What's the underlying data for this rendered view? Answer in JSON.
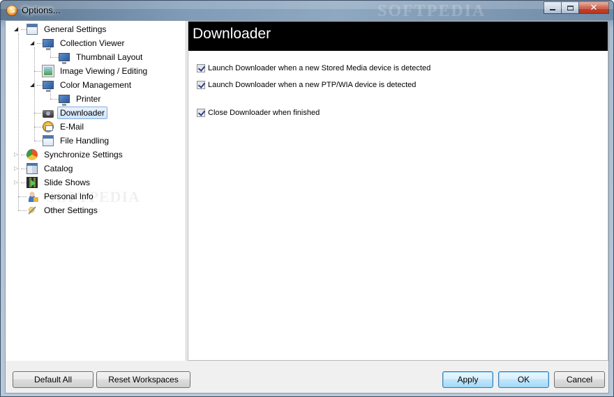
{
  "window": {
    "title": "Options...",
    "app_icon_glyph": "S",
    "watermark": "SOFTPEDIA",
    "controls": {
      "minimize": "minimize-icon",
      "maximize": "maximize-icon",
      "close": "✕"
    }
  },
  "tree": {
    "items": [
      {
        "label": "General Settings",
        "icon": "general-settings-icon",
        "expanded": true
      },
      {
        "label": "Collection Viewer",
        "icon": "collection-viewer-icon",
        "expanded": true
      },
      {
        "label": "Thumbnail Layout",
        "icon": "thumbnail-layout-icon"
      },
      {
        "label": "Image Viewing / Editing",
        "icon": "image-viewing-icon"
      },
      {
        "label": "Color Management",
        "icon": "color-management-icon",
        "expanded": true
      },
      {
        "label": "Printer",
        "icon": "printer-icon"
      },
      {
        "label": "Downloader",
        "icon": "downloader-camera-icon",
        "selected": true
      },
      {
        "label": "E-Mail",
        "icon": "email-icon"
      },
      {
        "label": "File Handling",
        "icon": "file-handling-icon"
      },
      {
        "label": "Synchronize Settings",
        "icon": "synchronize-icon",
        "expanded": false
      },
      {
        "label": "Catalog",
        "icon": "catalog-icon",
        "expanded": false
      },
      {
        "label": "Slide Shows",
        "icon": "slide-shows-icon",
        "expanded": false
      },
      {
        "label": "Personal Info",
        "icon": "personal-info-icon"
      },
      {
        "label": "Other Settings",
        "icon": "other-settings-icon"
      }
    ],
    "watermark": "SOFTPEDIA",
    "watermark_url": "www.softpedia.com"
  },
  "panel": {
    "title": "Downloader",
    "options": [
      {
        "label": "Launch Downloader when a new Stored Media device is detected",
        "checked": true
      },
      {
        "label": "Launch Downloader when a new PTP/WIA device is detected",
        "checked": true
      },
      {
        "label": "Close Downloader when finished",
        "checked": true
      }
    ]
  },
  "buttons": {
    "default_all": "Default All",
    "reset_workspaces": "Reset Workspaces",
    "apply": "Apply",
    "ok": "OK",
    "cancel": "Cancel"
  }
}
